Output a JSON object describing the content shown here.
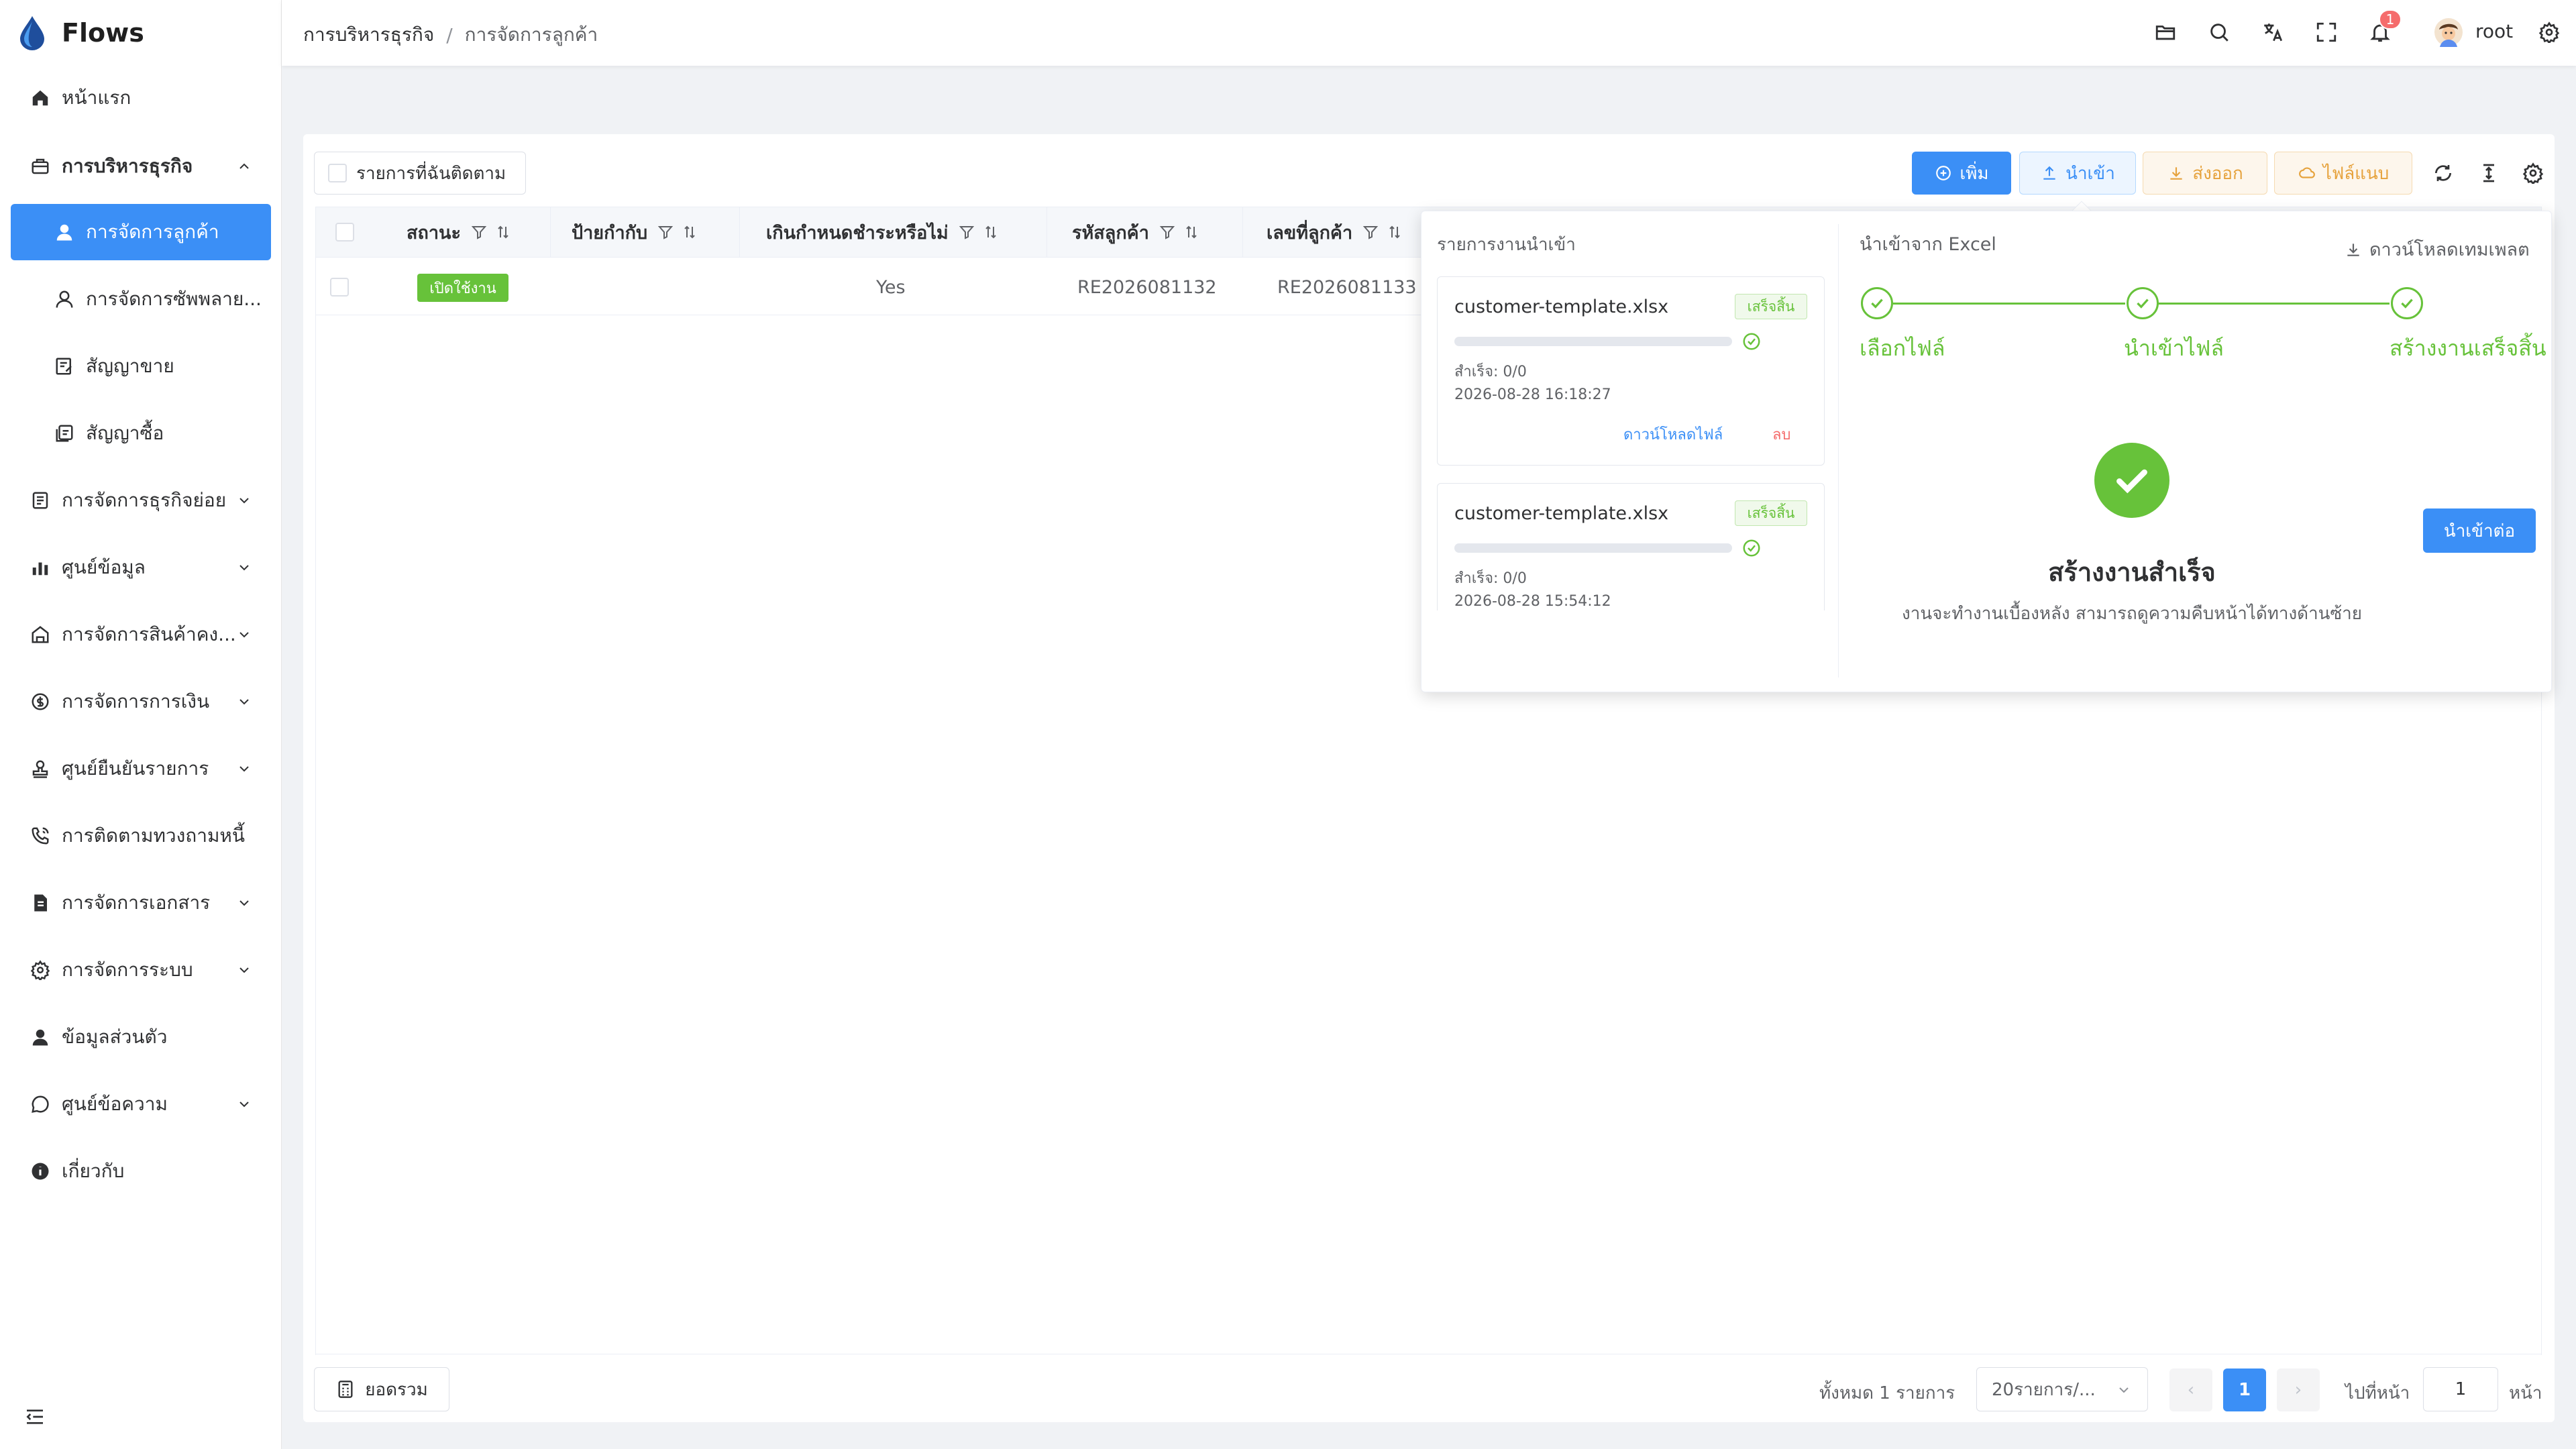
{
  "app": {
    "name": "Flows"
  },
  "colors": {
    "primary": "#3b8ff6",
    "success": "#67c23a",
    "warning": "#e6a23c",
    "danger": "#f56c6c"
  },
  "sidebar": {
    "items": [
      {
        "label": "หน้าแรก",
        "icon": "home-icon"
      },
      {
        "label": "การบริหารธุรกิจ",
        "icon": "briefcase-icon",
        "expanded": true
      },
      {
        "label": "การจัดการลูกค้า",
        "icon": "user-icon",
        "active": true
      },
      {
        "label": "การจัดการซัพพลาย...",
        "icon": "user-outline-icon"
      },
      {
        "label": "สัญญาขาย",
        "icon": "contract-edit-icon"
      },
      {
        "label": "สัญญาซื้อ",
        "icon": "contract-stack-icon"
      },
      {
        "label": "การจัดการธุรกิจย่อย",
        "icon": "document-list-icon"
      },
      {
        "label": "ศูนย์ข้อมูล",
        "icon": "bar-chart-icon"
      },
      {
        "label": "การจัดการสินค้าคง...",
        "icon": "warehouse-icon"
      },
      {
        "label": "การจัดการการเงิน",
        "icon": "money-icon"
      },
      {
        "label": "ศูนย์ยืนยันรายการ",
        "icon": "stamp-icon"
      },
      {
        "label": "การติดตามทวงถามหนี้",
        "icon": "phone-icon"
      },
      {
        "label": "การจัดการเอกสาร",
        "icon": "file-icon"
      },
      {
        "label": "การจัดการระบบ",
        "icon": "gear-icon"
      },
      {
        "label": "ข้อมูลส่วนตัว",
        "icon": "person-icon"
      },
      {
        "label": "ศูนย์ข้อความ",
        "icon": "chat-icon"
      },
      {
        "label": "เกี่ยวกับ",
        "icon": "info-icon"
      }
    ]
  },
  "header": {
    "breadcrumb": [
      "การบริหารธุรกิจ",
      "การจัดการลูกค้า"
    ],
    "breadcrumb_sep": "/",
    "notification_count": "1",
    "user": "root"
  },
  "toolbar": {
    "follow_label": "รายการที่ฉันติดตาม",
    "add": "เพิ่ม",
    "import": "นำเข้า",
    "export": "ส่งออก",
    "template": "ไฟล์แนบ"
  },
  "table": {
    "columns": [
      "สถานะ",
      "ป้ายกำกับ",
      "เกินกำหนดชำระหรือไม่",
      "รหัสลูกค้า",
      "เลขที่ลูกค้า"
    ],
    "rows": [
      {
        "status": "เปิดใช้งาน",
        "tag": "",
        "overdue": "Yes",
        "code": "RE2026081132",
        "number": "RE2026081133"
      }
    ]
  },
  "footer": {
    "summary": "ยอดรวม",
    "total": "ทั้งหมด 1 รายการ",
    "page_size": "20รายการ/...",
    "current_page": "1",
    "goto_label": "ไปที่หน้า",
    "goto_value": "1",
    "goto_suffix": "หน้า",
    "prev": "‹",
    "next": "›"
  },
  "import_popover": {
    "jobs_title": "รายการงานนำเข้า",
    "jobs": [
      {
        "file": "customer-template.xlsx",
        "status": "เสร็จสิ้น",
        "progress": 0,
        "success": "สำเร็จ: 0/0",
        "time": "2026-08-28 16:18:27",
        "download": "ดาวน์โหลดไฟล์",
        "delete": "ลบ"
      },
      {
        "file": "customer-template.xlsx",
        "status": "เสร็จสิ้น",
        "progress": 0,
        "success": "สำเร็จ: 0/0",
        "time": "2026-08-28 15:54:12"
      }
    ],
    "title": "นำเข้าจาก Excel",
    "download_template": "ดาวน์โหลดเทมเพลต",
    "steps": [
      "เลือกไฟล์",
      "นำเข้าไฟล์",
      "สร้างงานเสร็จสิ้น"
    ],
    "success_title": "สร้างงานสำเร็จ",
    "success_desc": "งานจะทำงานเบื้องหลัง สามารถดูความคืบหน้าได้ทางด้านซ้าย",
    "continue": "นำเข้าต่อ"
  }
}
